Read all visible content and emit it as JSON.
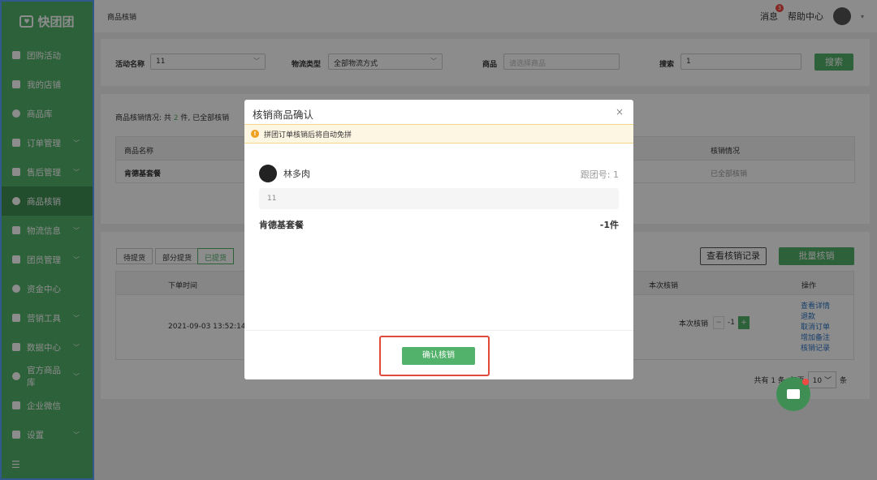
{
  "brand": {
    "name": "快团团"
  },
  "sidebar": {
    "items": [
      {
        "label": "团购活动",
        "icon": "calendar-icon",
        "chevron": false
      },
      {
        "label": "我的店铺",
        "icon": "store-icon",
        "chevron": false
      },
      {
        "label": "商品库",
        "icon": "box-icon",
        "chevron": false
      },
      {
        "label": "订单管理",
        "icon": "order-icon",
        "chevron": true
      },
      {
        "label": "售后管理",
        "icon": "aftersale-icon",
        "chevron": true
      },
      {
        "label": "商品核销",
        "icon": "verify-icon",
        "chevron": false,
        "active": true
      },
      {
        "label": "物流信息",
        "icon": "truck-icon",
        "chevron": true
      },
      {
        "label": "团员管理",
        "icon": "user-icon",
        "chevron": true
      },
      {
        "label": "资金中心",
        "icon": "money-icon",
        "chevron": false
      },
      {
        "label": "营销工具",
        "icon": "tag-icon",
        "chevron": true
      },
      {
        "label": "数据中心",
        "icon": "chart-icon",
        "chevron": true
      },
      {
        "label": "官方商品库",
        "icon": "heart-icon",
        "chevron": true
      },
      {
        "label": "企业微信",
        "icon": "wechat-icon",
        "chevron": false
      },
      {
        "label": "设置",
        "icon": "gear-icon",
        "chevron": true
      }
    ]
  },
  "header": {
    "breadcrumb": "商品核销",
    "messages": "消息",
    "badge": "3",
    "help": "帮助中心"
  },
  "filters": {
    "activity_label": "活动名称",
    "activity_value": "11",
    "logistics_label": "物流类型",
    "logistics_value": "全部物流方式",
    "product_label": "商品",
    "product_placeholder": "请选择商品",
    "search_label": "搜索",
    "search_value": "1",
    "search_button": "搜索"
  },
  "summary": {
    "text_prefix": "商品核销情况: 共 ",
    "count": "2",
    "text_suffix": " 件, 已全部核销",
    "col_name": "商品名称",
    "col_status": "核销情况",
    "row_name": "肯德基套餐",
    "row_status": "已全部核销"
  },
  "orders": {
    "tabs": [
      "待提货",
      "部分提货",
      "已提货"
    ],
    "view_log_button": "查看核销记录",
    "batch_button": "批量核销",
    "col_time": "下单时间",
    "col_current": "本次核销",
    "col_ops": "操作",
    "row_time": "2021-09-03 13:52:14",
    "row_current_label": "本次核销",
    "row_qty": "-1",
    "ops": [
      "查看详情",
      "退款",
      "取消订单",
      "增加备注",
      "核销记录"
    ],
    "pager": {
      "total": "共有 1 条, 每页",
      "size": "10",
      "unit": "条"
    }
  },
  "modal": {
    "title": "核销商品确认",
    "close": "×",
    "warning": "拼团订单核销后将自动免拼",
    "user": "林多肉",
    "group_no": "跟团号: 1",
    "note": "11",
    "product": "肯德基套餐",
    "qty": "-1件",
    "confirm_button": "确认核销"
  }
}
